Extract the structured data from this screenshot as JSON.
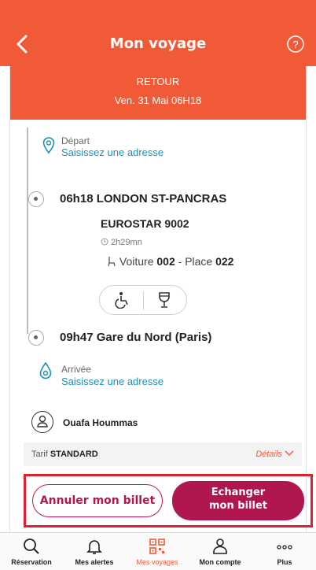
{
  "header": {
    "title": "Mon voyage"
  },
  "trip": {
    "direction": "RETOUR",
    "date": "Ven. 31 Mai 06H18"
  },
  "departure_address": {
    "label": "Départ",
    "placeholder": "Saisissez une adresse"
  },
  "segment": {
    "dep_time": "06h18",
    "dep_station": "LONDON ST-PANCRAS",
    "train": "EUROSTAR 9002",
    "duration": "2h29mn",
    "car_label": "Voiture",
    "car_number": "002",
    "seat_label": "Place",
    "seat_number": "022",
    "arr_time": "09h47",
    "arr_station": "Gare du Nord (Paris)",
    "amenities": [
      "wheelchair-icon",
      "wine-glass-icon"
    ]
  },
  "arrival_address": {
    "label": "Arrivée",
    "placeholder": "Saisissez une adresse"
  },
  "passenger": {
    "name": "Ouafa Hoummas"
  },
  "tarif": {
    "prefix": "Tarif",
    "value": "STANDARD",
    "details": "Détails"
  },
  "actions": {
    "cancel": "Annuler mon billet",
    "exchange_line1": "Echanger",
    "exchange_line2": "mon billet"
  },
  "tabs": [
    {
      "label": "Réservation",
      "icon": "search-icon"
    },
    {
      "label": "Mes alertes",
      "icon": "bell-icon"
    },
    {
      "label": "Mes voyages",
      "icon": "qr-code-icon",
      "active": true
    },
    {
      "label": "Mon compte",
      "icon": "user-icon"
    },
    {
      "label": "Plus",
      "icon": "more-icon"
    }
  ],
  "colors": {
    "brand": "#f05a36",
    "accent": "#b0174f",
    "link": "#1a8fb8",
    "highlight": "#e0202e"
  }
}
